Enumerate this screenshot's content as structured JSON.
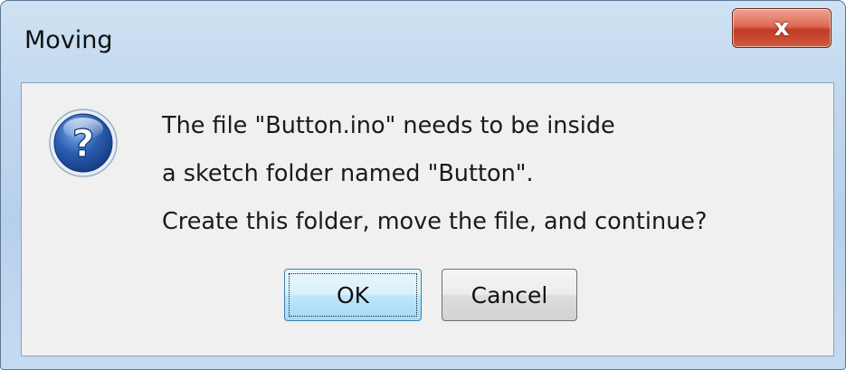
{
  "window": {
    "title": "Moving"
  },
  "titlebar": {
    "close_glyph": "x",
    "close_icon": "close-icon"
  },
  "dialog": {
    "icon": "question-icon",
    "icon_glyph": "?",
    "message_lines": [
      "The file \"Button.ino\" needs to be inside",
      "a sketch folder named \"Button\".",
      "Create this folder, move the file, and continue?"
    ],
    "buttons": {
      "ok_label": "OK",
      "cancel_label": "Cancel"
    }
  },
  "colors": {
    "titlebar_blue": "#c0d7ee",
    "close_red": "#c23a24",
    "client_bg": "#f0f0f0",
    "icon_blue": "#2a5db0"
  }
}
